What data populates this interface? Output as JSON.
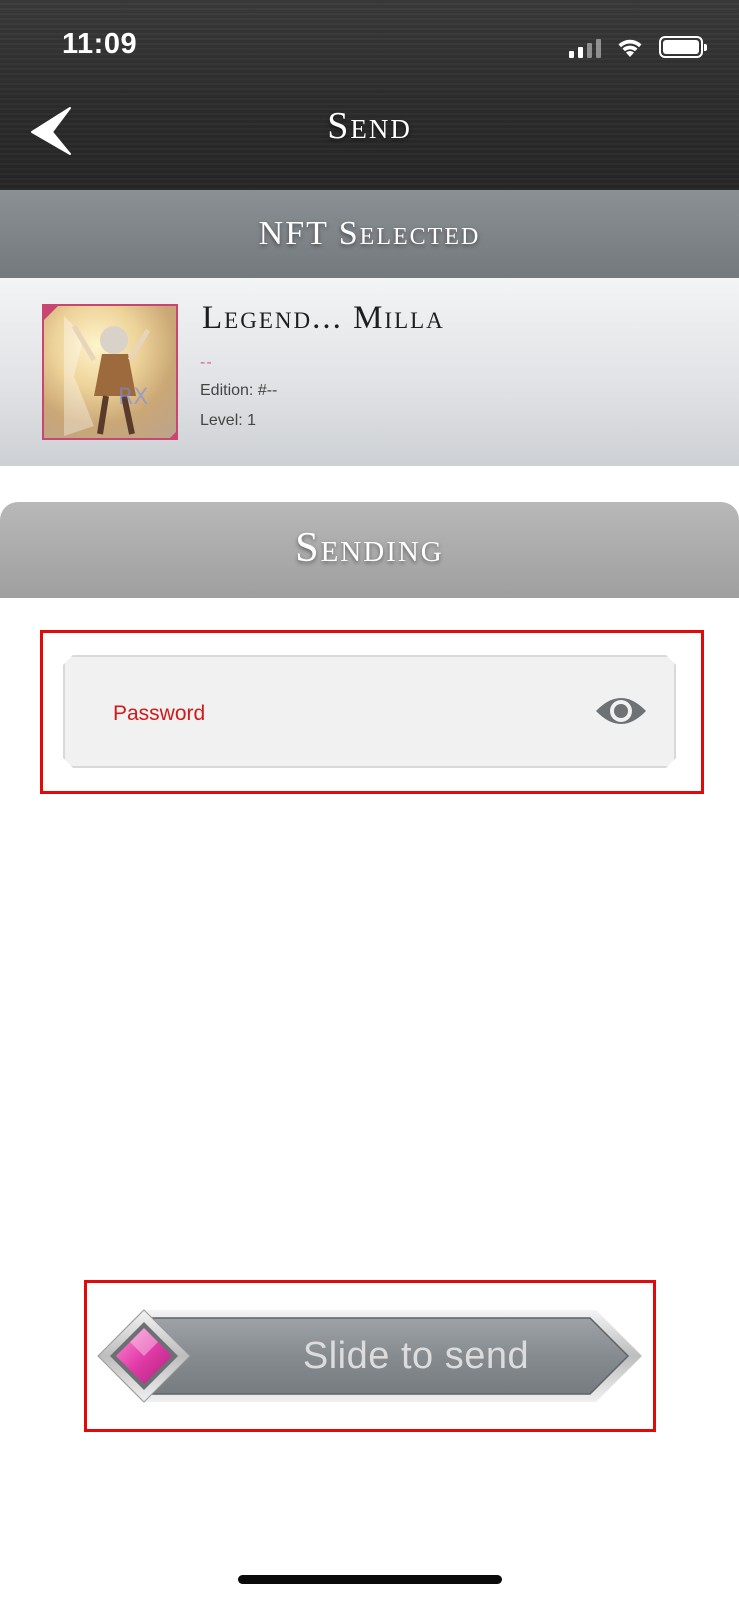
{
  "status_bar": {
    "time": "11:09"
  },
  "nav": {
    "title": "Send"
  },
  "nft_section": {
    "banner": "NFT Selected",
    "title": "Legend... Milla",
    "subtitle": "--",
    "edition": "Edition: #--",
    "level": "Level: 1"
  },
  "sending_section": {
    "banner": "Sending",
    "password_placeholder": "Password"
  },
  "slider": {
    "label": "Slide to send"
  },
  "colors": {
    "header_dark": "#2c2c2c",
    "banner_gray": "#7c8186",
    "password_label_red": "#d11a1a",
    "annotation_red": "#e00a0a",
    "slider_gem_pink": "#e23ca8"
  },
  "icons": {
    "back": "back-arrow-icon",
    "eye": "eye-icon",
    "gem": "diamond-gem-icon",
    "wifi": "wifi-icon",
    "signal": "signal-icon",
    "battery": "battery-icon"
  }
}
